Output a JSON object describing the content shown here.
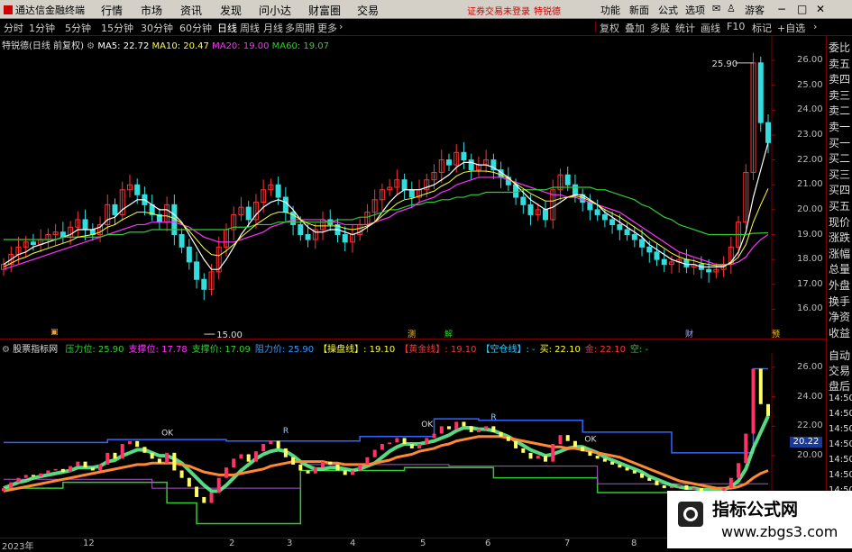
{
  "menubar": {
    "app_title": "通达信金融终端",
    "items": [
      "行情",
      "市场",
      "资讯",
      "发现",
      "问小达",
      "财富圈",
      "交易"
    ],
    "login_warning": "证券交易未登录",
    "stock_name_red": "特锐德",
    "right_items": [
      "功能",
      "新面",
      "公式",
      "选项"
    ],
    "rooms_label": "游客"
  },
  "toolbar": {
    "periods": [
      "分时",
      "1分钟",
      "5分钟",
      "15分钟",
      "30分钟",
      "60分钟",
      "日线",
      "周线",
      "月线",
      "多周期",
      "更多"
    ],
    "active_period": "日线",
    "right_buttons": [
      "复权",
      "叠加",
      "多股",
      "统计",
      "画线",
      "F10",
      "标记",
      "+自选"
    ]
  },
  "price_chart": {
    "title": "特锐德(日线 前复权)",
    "ma": [
      {
        "label": "MA5: 22.72",
        "color": "#ffffff"
      },
      {
        "label": "MA10: 20.47",
        "color": "#ffff33"
      },
      {
        "label": "MA20: 19.00",
        "color": "#ff33ff"
      },
      {
        "label": "MA60: 19.07",
        "color": "#33cc33"
      }
    ],
    "y_ticks": [
      "26.00",
      "25.00",
      "24.00",
      "23.00",
      "22.00",
      "21.00",
      "20.00",
      "19.00",
      "18.00",
      "17.00",
      "16.00"
    ],
    "high_label": "25.90",
    "low_label": "15.00",
    "event_markers": [
      "测",
      "解",
      "财",
      "预"
    ]
  },
  "indicator_panel": {
    "name": "股票指标网",
    "items": [
      {
        "label": "压力位:",
        "value": "25.90",
        "color": "#33cc33"
      },
      {
        "label": "支撑位:",
        "value": "17.78",
        "color": "#ff33ff"
      },
      {
        "label": "支撑价:",
        "value": "17.09",
        "color": "#33cc33"
      },
      {
        "label": "阻力价:",
        "value": "25.90",
        "color": "#3399ff"
      },
      {
        "label": "【操盘线】:",
        "value": "19.10",
        "color": "#ffff33"
      },
      {
        "label": "【黄金线】:",
        "value": "19.10",
        "color": "#ff3333"
      },
      {
        "label": "【空仓线】:",
        "value": "-",
        "color": "#33ccff"
      },
      {
        "label": "买:",
        "value": "22.10",
        "color": "#ffff33"
      },
      {
        "label": "金:",
        "value": "22.10",
        "color": "#ff3333"
      },
      {
        "label": "空:",
        "value": "-",
        "color": "#33cc33"
      }
    ],
    "y_ticks": [
      "26.00",
      "24.00",
      "22.00",
      "20.00"
    ],
    "current_value": "20.22",
    "ok_label": "OK",
    "r_label": "R"
  },
  "right_panel": {
    "upper": [
      "委比",
      "卖五",
      "卖四",
      "卖三",
      "卖二",
      "卖一",
      "买一",
      "买二",
      "买三",
      "买四",
      "买五",
      "现价",
      "涨跌",
      "涨幅",
      "总量",
      "外盘",
      "换手",
      "净资",
      "收益"
    ],
    "lower": [
      "自动",
      "交易",
      "盘后",
      "14:50",
      "14:50",
      "14:50",
      "14:50",
      "14:50",
      "14:50",
      "14:50",
      "14:50"
    ]
  },
  "date_axis": [
    "2023年",
    "12",
    "2",
    "3",
    "4",
    "5",
    "6",
    "7",
    "8"
  ],
  "watermark": {
    "line1": "指标公式网",
    "line2": "www.zbgs3.com"
  },
  "chart_data": {
    "type": "line",
    "title": "特锐德(日线 前复权)",
    "ylim": [
      15.0,
      26.5
    ],
    "series": [
      {
        "name": "close",
        "values": [
          17.8,
          18.2,
          18.5,
          18.7,
          18.6,
          18.8,
          19.0,
          19.1,
          18.9,
          19.3,
          19.6,
          19.2,
          19.0,
          19.4,
          20.2,
          19.8,
          20.8,
          21.0,
          20.6,
          20.2,
          19.8,
          19.5,
          20.2,
          19.0,
          18.5,
          17.9,
          17.2,
          16.8,
          17.5,
          18.5,
          19.2,
          19.8,
          20.1,
          19.6,
          20.3,
          20.8,
          21.0,
          20.5,
          19.9,
          19.4,
          19.0,
          18.8,
          19.2,
          19.6,
          19.4,
          19.0,
          18.7,
          19.0,
          19.4,
          19.9,
          20.4,
          20.8,
          20.9,
          21.2,
          20.8,
          20.5,
          20.8,
          21.2,
          21.5,
          22.0,
          21.8,
          22.3,
          22.0,
          21.6,
          21.8,
          22.0,
          21.6,
          21.3,
          21.0,
          20.5,
          20.2,
          19.8,
          20.0,
          19.6,
          20.8,
          21.4,
          21.0,
          20.6,
          20.3,
          20.0,
          19.8,
          19.6,
          19.4,
          19.2,
          19.0,
          18.8,
          18.5,
          18.3,
          18.0,
          17.8,
          17.9,
          18.0,
          17.7,
          17.8,
          17.6,
          17.5,
          17.6,
          17.8,
          18.5,
          19.5,
          21.5,
          25.9,
          23.5,
          22.7
        ]
      },
      {
        "name": "MA5",
        "values": [
          17.8,
          18.0,
          18.2,
          18.3,
          18.5,
          18.6,
          18.7,
          18.8,
          18.9,
          19.0,
          19.2,
          19.2,
          19.2,
          19.3,
          19.6,
          19.7,
          20.0,
          20.2,
          20.4,
          20.4,
          20.2,
          20.0,
          20.0,
          19.8,
          19.5,
          19.0,
          18.5,
          18.0,
          17.6,
          17.6,
          18.0,
          18.5,
          19.0,
          19.4,
          19.8,
          20.1,
          20.3,
          20.4,
          20.3,
          20.0,
          19.6,
          19.3,
          19.1,
          19.1,
          19.2,
          19.2,
          19.1,
          19.0,
          19.1,
          19.3,
          19.5,
          19.9,
          20.3,
          20.6,
          20.8,
          20.8,
          20.8,
          20.9,
          21.0,
          21.2,
          21.4,
          21.7,
          21.9,
          21.9,
          21.8,
          21.8,
          21.7,
          21.5,
          21.3,
          21.0,
          20.7,
          20.4,
          20.2,
          20.0,
          20.1,
          20.3,
          20.5,
          20.6,
          20.6,
          20.4,
          20.2,
          19.9,
          19.7,
          19.5,
          19.3,
          19.1,
          18.9,
          18.6,
          18.4,
          18.2,
          18.0,
          17.9,
          17.8,
          17.8,
          17.7,
          17.7,
          17.7,
          17.7,
          17.9,
          18.3,
          19.1,
          20.5,
          21.6,
          22.7
        ]
      },
      {
        "name": "MA20",
        "values": [
          17.6,
          17.7,
          17.8,
          17.9,
          18.0,
          18.1,
          18.2,
          18.3,
          18.4,
          18.5,
          18.6,
          18.7,
          18.8,
          18.9,
          19.0,
          19.1,
          19.2,
          19.3,
          19.4,
          19.4,
          19.5,
          19.5,
          19.5,
          19.5,
          19.4,
          19.3,
          19.1,
          18.9,
          18.8,
          18.7,
          18.7,
          18.7,
          18.8,
          18.9,
          19.0,
          19.1,
          19.3,
          19.4,
          19.5,
          19.6,
          19.6,
          19.6,
          19.6,
          19.6,
          19.5,
          19.5,
          19.4,
          19.4,
          19.4,
          19.4,
          19.5,
          19.6,
          19.7,
          19.9,
          20.0,
          20.1,
          20.3,
          20.4,
          20.5,
          20.7,
          20.8,
          21.0,
          21.1,
          21.2,
          21.3,
          21.3,
          21.3,
          21.3,
          21.2,
          21.1,
          21.0,
          20.9,
          20.8,
          20.7,
          20.6,
          20.6,
          20.5,
          20.5,
          20.4,
          20.3,
          20.2,
          20.1,
          20.0,
          19.9,
          19.7,
          19.5,
          19.3,
          19.1,
          18.9,
          18.7,
          18.5,
          18.3,
          18.2,
          18.1,
          18.0,
          17.9,
          17.8,
          17.8,
          17.8,
          17.9,
          18.1,
          18.5,
          18.8,
          19.0
        ]
      },
      {
        "name": "MA60",
        "values": [
          18.8,
          18.8,
          18.8,
          18.8,
          18.8,
          18.8,
          18.8,
          18.8,
          18.9,
          18.9,
          18.9,
          18.9,
          18.9,
          18.9,
          19.0,
          19.0,
          19.0,
          19.1,
          19.1,
          19.1,
          19.2,
          19.2,
          19.2,
          19.2,
          19.2,
          19.2,
          19.2,
          19.2,
          19.2,
          19.2,
          19.2,
          19.3,
          19.3,
          19.3,
          19.4,
          19.4,
          19.4,
          19.5,
          19.5,
          19.5,
          19.5,
          19.5,
          19.5,
          19.5,
          19.5,
          19.6,
          19.6,
          19.6,
          19.7,
          19.7,
          19.8,
          19.9,
          20.0,
          20.0,
          20.1,
          20.2,
          20.2,
          20.3,
          20.3,
          20.4,
          20.4,
          20.5,
          20.5,
          20.6,
          20.6,
          20.7,
          20.7,
          20.7,
          20.7,
          20.7,
          20.8,
          20.8,
          20.8,
          20.8,
          20.9,
          20.9,
          20.9,
          20.9,
          20.9,
          20.9,
          20.8,
          20.8,
          20.7,
          20.6,
          20.5,
          20.4,
          20.2,
          20.1,
          19.9,
          19.7,
          19.6,
          19.4,
          19.3,
          19.2,
          19.1,
          19.0,
          19.0,
          19.0,
          19.0,
          19.0,
          19.0,
          19.05,
          19.06,
          19.07
        ]
      }
    ]
  }
}
